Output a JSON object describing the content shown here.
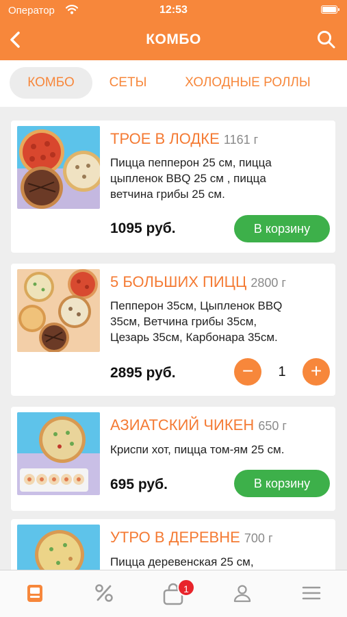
{
  "status": {
    "carrier": "Оператор",
    "time": "12:53"
  },
  "nav": {
    "title": "КОМБО",
    "back_icon": "chevron-left-icon",
    "search_icon": "search-icon"
  },
  "tabs": [
    {
      "label": "КОМБО",
      "active": true
    },
    {
      "label": "СЕТЫ",
      "active": false
    },
    {
      "label": "ХОЛОДНЫЕ РОЛЛЫ",
      "active": false
    }
  ],
  "products": [
    {
      "title": "ТРОЕ В ЛОДКЕ",
      "weight": "1161 г",
      "desc": [
        "Пицца пепперон 25 см, пицца",
        "цыпленок BBQ 25 см , пицца",
        "ветчина грибы 25 см."
      ],
      "price": "1095 руб.",
      "cart_label": "В корзину"
    },
    {
      "title": "5 БОЛЬШИХ ПИЦЦ",
      "weight": "2800 г",
      "desc": [
        "Пепперон 35см, Цыпленок BBQ",
        "35см, Ветчина грибы 35см,",
        "Цезарь 35см, Карбонара 35см."
      ],
      "price": "2895 руб.",
      "quantity": "1",
      "minus": "−",
      "plus": "+"
    },
    {
      "title": "АЗИАТСКИЙ ЧИКЕН",
      "weight": "650 г",
      "desc": [
        "Криспи хот, пицца том-ям 25 см."
      ],
      "price": "695 руб.",
      "cart_label": "В корзину"
    },
    {
      "title": "УТРО В ДЕРЕВНЕ",
      "weight": "700 г",
      "desc": [
        "Пицца деревенская 25 см,"
      ]
    }
  ],
  "bottom_nav": [
    {
      "icon": "menu-card-icon",
      "active": true
    },
    {
      "icon": "percent-icon"
    },
    {
      "icon": "cart-bag-icon",
      "badge": "1"
    },
    {
      "icon": "profile-icon"
    },
    {
      "icon": "hamburger-menu-icon"
    }
  ],
  "colors": {
    "accent": "#f7873b",
    "title": "#f47a33",
    "cart": "#3db04a",
    "badge": "#e8242b",
    "inactive_icon": "#9a9a9a"
  }
}
